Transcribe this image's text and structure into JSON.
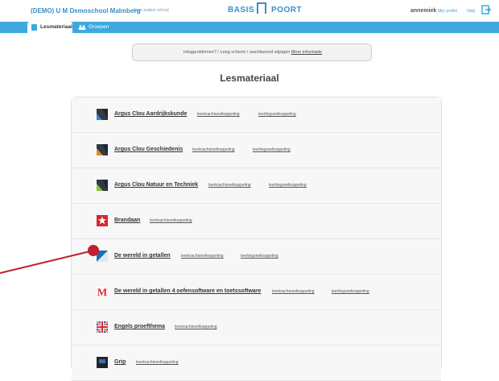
{
  "header": {
    "school_name": "(DEMO) U M Demoschool Malmberg",
    "other_school": "Naar andere school",
    "brand_left": "BASIS",
    "brand_right": "POORT",
    "user": "annemiek",
    "profile_link": "Mijn profiel",
    "help_link": "Help"
  },
  "tabs": [
    {
      "label": "Lesmateriaal",
      "active": true
    },
    {
      "label": "Groepen",
      "active": false
    }
  ],
  "notice": {
    "text": "Inlogproblemen? / Leeg scherm / wachtwoord wijzigen",
    "link": "Meer informatie"
  },
  "page_title": "Lesmateriaal",
  "items": [
    {
      "title": "Argus Clou Aardrijkskunde",
      "links": [
        "leerkrachtsnelkoppeling",
        "leerlingsnelkoppeling"
      ],
      "icon": "argus-icon"
    },
    {
      "title": "Argus Clou Geschiedenis",
      "links": [
        "leerkrachtsnelkoppeling",
        "leerlingsnelkoppeling"
      ],
      "icon": "argus-icon"
    },
    {
      "title": "Argus Clou Natuur en Techniek",
      "links": [
        "leerkrachtsnelkoppeling",
        "leerlingsnelkoppeling"
      ],
      "icon": "argus-icon"
    },
    {
      "title": "Brandaan",
      "links": [
        "leerkrachtsnelkoppeling"
      ],
      "icon": "star-icon"
    },
    {
      "title": "De wereld in getallen",
      "links": [
        "leerkrachtsnelkoppeling",
        "leerlingsnelkoppeling"
      ],
      "icon": "wereld-icon"
    },
    {
      "title": "De wereld in getallen 4 oefensoftware en toetssoftware",
      "links": [
        "leerkrachtsnelkoppeling",
        "leerlingsnelkoppeling"
      ],
      "icon": "malmberg-m-icon"
    },
    {
      "title": "Engels proefthema",
      "links": [
        "leerkrachtsnelkoppeling"
      ],
      "icon": "union-jack-icon"
    },
    {
      "title": "Grip",
      "links": [
        "leerkrachtsnelkoppeling"
      ],
      "icon": "grip-icon"
    }
  ],
  "colors": {
    "accent": "#3da9dc",
    "brand": "#3b8ec9",
    "pointer": "#c0202e"
  }
}
